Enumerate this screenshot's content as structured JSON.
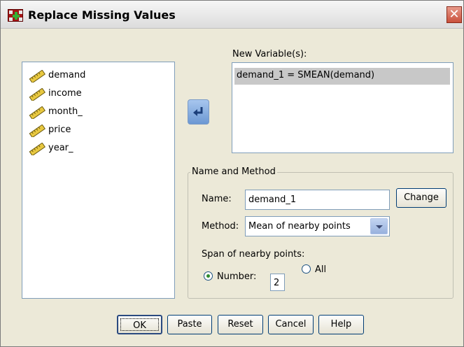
{
  "window": {
    "title": "Replace Missing Values",
    "close_glyph": "✕"
  },
  "variables": [
    {
      "label": "demand",
      "icon": "ruler-icon"
    },
    {
      "label": "income",
      "icon": "ruler-icon"
    },
    {
      "label": "month_",
      "icon": "ruler-icon"
    },
    {
      "label": "price",
      "icon": "ruler-icon"
    },
    {
      "label": "year_",
      "icon": "ruler-icon"
    }
  ],
  "new_variables": {
    "label": "New Variable(s):",
    "items": [
      "demand_1 = SMEAN(demand)"
    ]
  },
  "name_method": {
    "legend": "Name and Method",
    "name_label": "Name:",
    "name_value": "demand_1",
    "change_label": "Change",
    "method_label": "Method:",
    "method_value": "Mean of nearby points",
    "span_label": "Span of nearby points:",
    "number_label": "Number:",
    "number_value": "2",
    "all_label": "All"
  },
  "buttons": {
    "ok": "OK",
    "paste": "Paste",
    "reset": "Reset",
    "cancel": "Cancel",
    "help": "Help"
  },
  "colors": {
    "dialog_bg": "#ece9d8",
    "selection": "#c8c8c8",
    "arrow_button": "#6c98d3"
  }
}
